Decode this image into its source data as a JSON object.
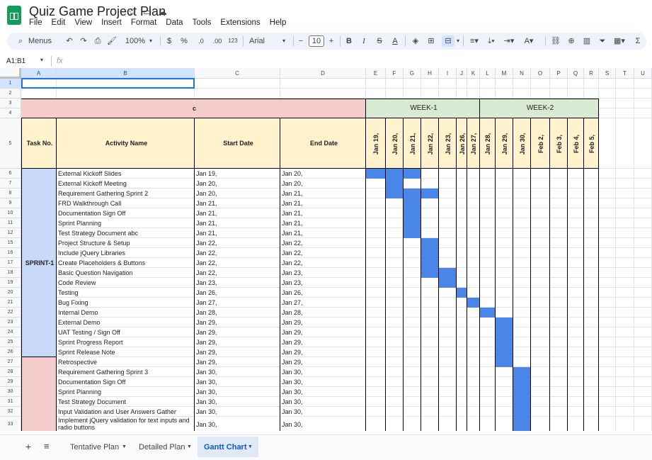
{
  "app": {
    "title": "Quiz Game Project Plan",
    "menus": [
      "File",
      "Edit",
      "View",
      "Insert",
      "Format",
      "Data",
      "Tools",
      "Extensions",
      "Help"
    ]
  },
  "toolbar": {
    "menus_label": "Menus",
    "zoom": "100%",
    "currency": "$",
    "percent": "%",
    "dec_decrease": ".0",
    "dec_increase": ".00",
    "number_format": "123",
    "font": "Arial",
    "font_size": "10"
  },
  "formula_bar": {
    "name_box": "A1:B1",
    "fx": "fx"
  },
  "columns": [
    "A",
    "B",
    "C",
    "D",
    "E",
    "F",
    "G",
    "H",
    "I",
    "J",
    "K",
    "L",
    "M",
    "N",
    "O",
    "P",
    "Q",
    "R",
    "S",
    "T",
    "U"
  ],
  "row_numbers": [
    "1",
    "2",
    "3",
    "4",
    "5",
    "6",
    "7",
    "8",
    "9",
    "10",
    "11",
    "12",
    "15",
    "16",
    "17",
    "18",
    "19",
    "20",
    "21",
    "22",
    "23",
    "24",
    "25",
    "26",
    "27",
    "28",
    "29",
    "30",
    "31",
    "32",
    "33"
  ],
  "sheet": {
    "header_c": "c",
    "week1": "WEEK-1",
    "week2": "WEEK-2",
    "col_task_no": "Task No.",
    "col_activity": "Activity Name",
    "col_start": "Start Date",
    "col_end": "End Date",
    "day_labels": [
      "Jan 19,",
      "Jan 20,",
      "Jan 21,",
      "Jan 22,",
      "Jan 23,",
      "Jan 26,",
      "Jan 27,",
      "Jan 28,",
      "Jan 29,",
      "Jan 30,",
      "Feb 2,",
      "Feb 3,",
      "Feb 4,",
      "Feb 5,"
    ],
    "sprint_label": "SPRINT-1",
    "tasks": [
      {
        "name": "External Kickoff Slides",
        "start": "Jan 19,",
        "end": "Jan 20,",
        "bar": [
          0,
          2
        ]
      },
      {
        "name": "External Kickoff Meeting",
        "start": "Jan 20,",
        "end": "Jan 20,",
        "bar": [
          1,
          1
        ]
      },
      {
        "name": "Requirement Gathering Sprint 2",
        "start": "Jan 20,",
        "end": "Jan 21,",
        "bar": [
          1,
          3
        ]
      },
      {
        "name": "FRD Walkthrough Call",
        "start": "Jan 21,",
        "end": "Jan 21,",
        "bar": [
          2,
          2
        ]
      },
      {
        "name": "Documentation Sign Off",
        "start": "Jan 21,",
        "end": "Jan 21,",
        "bar": [
          2,
          2
        ]
      },
      {
        "name": "Sprint Planning",
        "start": "Jan 21,",
        "end": "Jan 21,",
        "bar": [
          2,
          2
        ]
      },
      {
        "name": "Test Strategy Document abc",
        "start": "Jan 21,",
        "end": "Jan 21,",
        "bar": [
          2,
          2
        ]
      },
      {
        "name": "Project Structure & Setup",
        "start": "Jan 22,",
        "end": "Jan 22,",
        "bar": [
          3,
          3
        ]
      },
      {
        "name": "Include jQuery Libraries",
        "start": "Jan 22,",
        "end": "Jan 22,",
        "bar": [
          3,
          3
        ]
      },
      {
        "name": "Create Placeholders & Buttons",
        "start": "Jan 22,",
        "end": "Jan 22,",
        "bar": [
          3,
          3
        ]
      },
      {
        "name": "Basic Question Navigation",
        "start": "Jan 22,",
        "end": "Jan 23,",
        "bar": [
          3,
          4
        ]
      },
      {
        "name": "Code Review",
        "start": "Jan 23,",
        "end": "Jan 23,",
        "bar": [
          4,
          4
        ]
      },
      {
        "name": "Testing",
        "start": "Jan 26,",
        "end": "Jan 26,",
        "bar": [
          5,
          5
        ]
      },
      {
        "name": "Bug Fixing",
        "start": "Jan 27,",
        "end": "Jan 27,",
        "bar": [
          6,
          6
        ]
      },
      {
        "name": "Internal Demo",
        "start": "Jan 28,",
        "end": "Jan 28,",
        "bar": [
          7,
          7
        ]
      },
      {
        "name": "External Demo",
        "start": "Jan 29,",
        "end": "Jan 29,",
        "bar": [
          8,
          8
        ]
      },
      {
        "name": "UAT Testing / Sign Off",
        "start": "Jan 29,",
        "end": "Jan 29,",
        "bar": [
          8,
          8
        ]
      },
      {
        "name": "Sprint Progress Report",
        "start": "Jan 29,",
        "end": "Jan 29,",
        "bar": [
          8,
          8
        ]
      },
      {
        "name": "Sprint Release Note",
        "start": "Jan 29,",
        "end": "Jan 29,",
        "bar": [
          8,
          8
        ]
      },
      {
        "name": "Retrospective",
        "start": "Jan 29,",
        "end": "Jan 29,",
        "bar": [
          8,
          8
        ]
      },
      {
        "name": "Requirement Gathering Sprint 3",
        "start": "Jan 30,",
        "end": "Jan 30,",
        "bar": [
          9,
          9
        ]
      },
      {
        "name": "Documentation Sign Off",
        "start": "Jan 30,",
        "end": "Jan 30,",
        "bar": [
          9,
          9
        ]
      },
      {
        "name": "Sprint Planning",
        "start": "Jan 30,",
        "end": "Jan 30,",
        "bar": [
          9,
          9
        ]
      },
      {
        "name": "Test Strategy Document",
        "start": "Jan 30,",
        "end": "Jan 30,",
        "bar": [
          9,
          9
        ]
      },
      {
        "name": " Input Validation and User Answers Gather",
        "start": "Jan 30,",
        "end": "Jan 30,",
        "bar": [
          9,
          9
        ]
      },
      {
        "name": "Implement jQuery validation for text inputs and radio buttons",
        "start": "Jan 30,",
        "end": "Jan 30,",
        "bar": [
          9,
          9
        ]
      }
    ]
  },
  "tabs": [
    "Tentative Plan",
    "Detailed Plan",
    "Gantt Chart"
  ],
  "active_tab": "Gantt Chart",
  "colors": {
    "header_pink": "#f4cccc",
    "week_green": "#d9ead3",
    "header_yellow": "#fff2cc",
    "sprint1_blue": "#c9daf8",
    "sprint2_pink": "#f4cccc",
    "bar_blue": "#4a86e8"
  }
}
